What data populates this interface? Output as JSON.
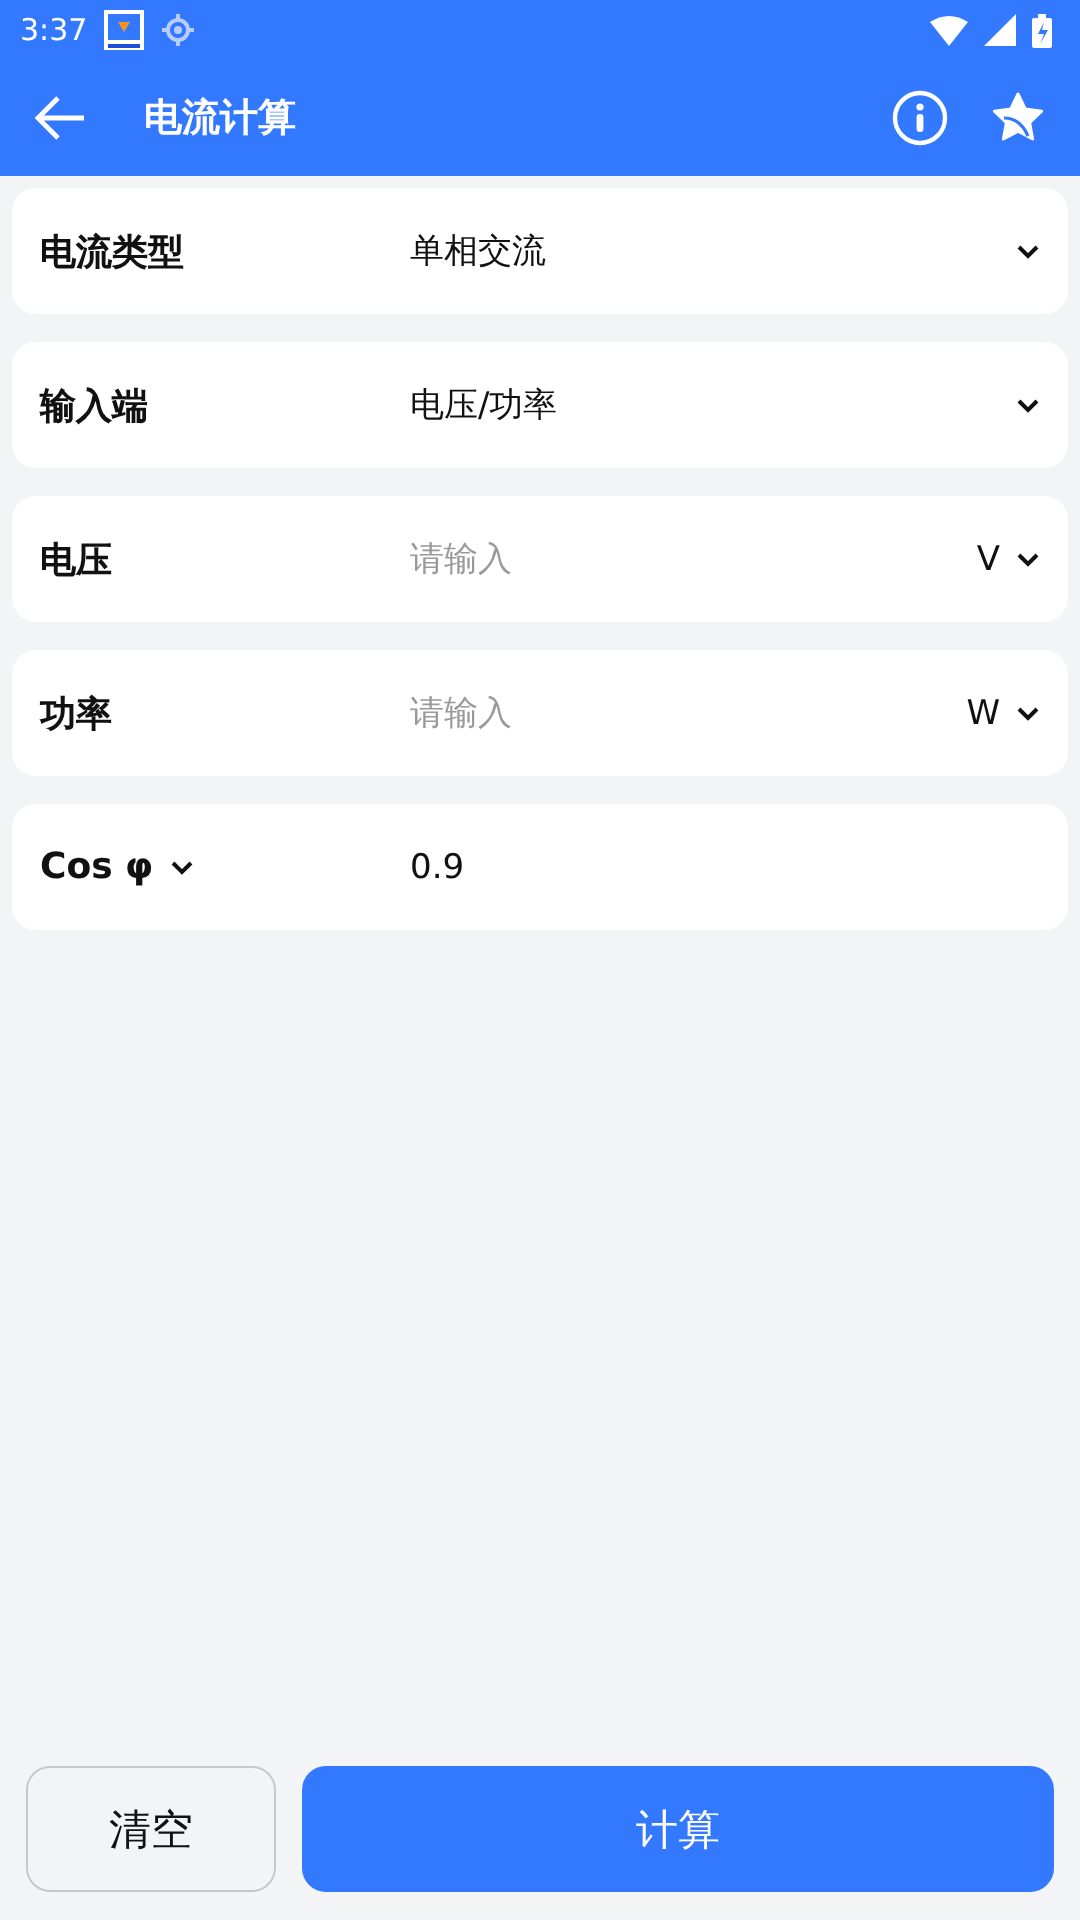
{
  "status_bar": {
    "time": "3:37"
  },
  "app_bar": {
    "title": "电流计算"
  },
  "fields": [
    {
      "kind": "select",
      "label": "电流类型",
      "value": "单相交流"
    },
    {
      "kind": "select",
      "label": "输入端",
      "value": "电压/功率"
    },
    {
      "kind": "input",
      "label": "电压",
      "placeholder": "请输入",
      "unit": "V"
    },
    {
      "kind": "input",
      "label": "功率",
      "placeholder": "请输入",
      "unit": "W"
    },
    {
      "kind": "label_select",
      "label": "Cos φ",
      "value": "0.9"
    }
  ],
  "buttons": {
    "clear": "清空",
    "calculate": "计算"
  }
}
